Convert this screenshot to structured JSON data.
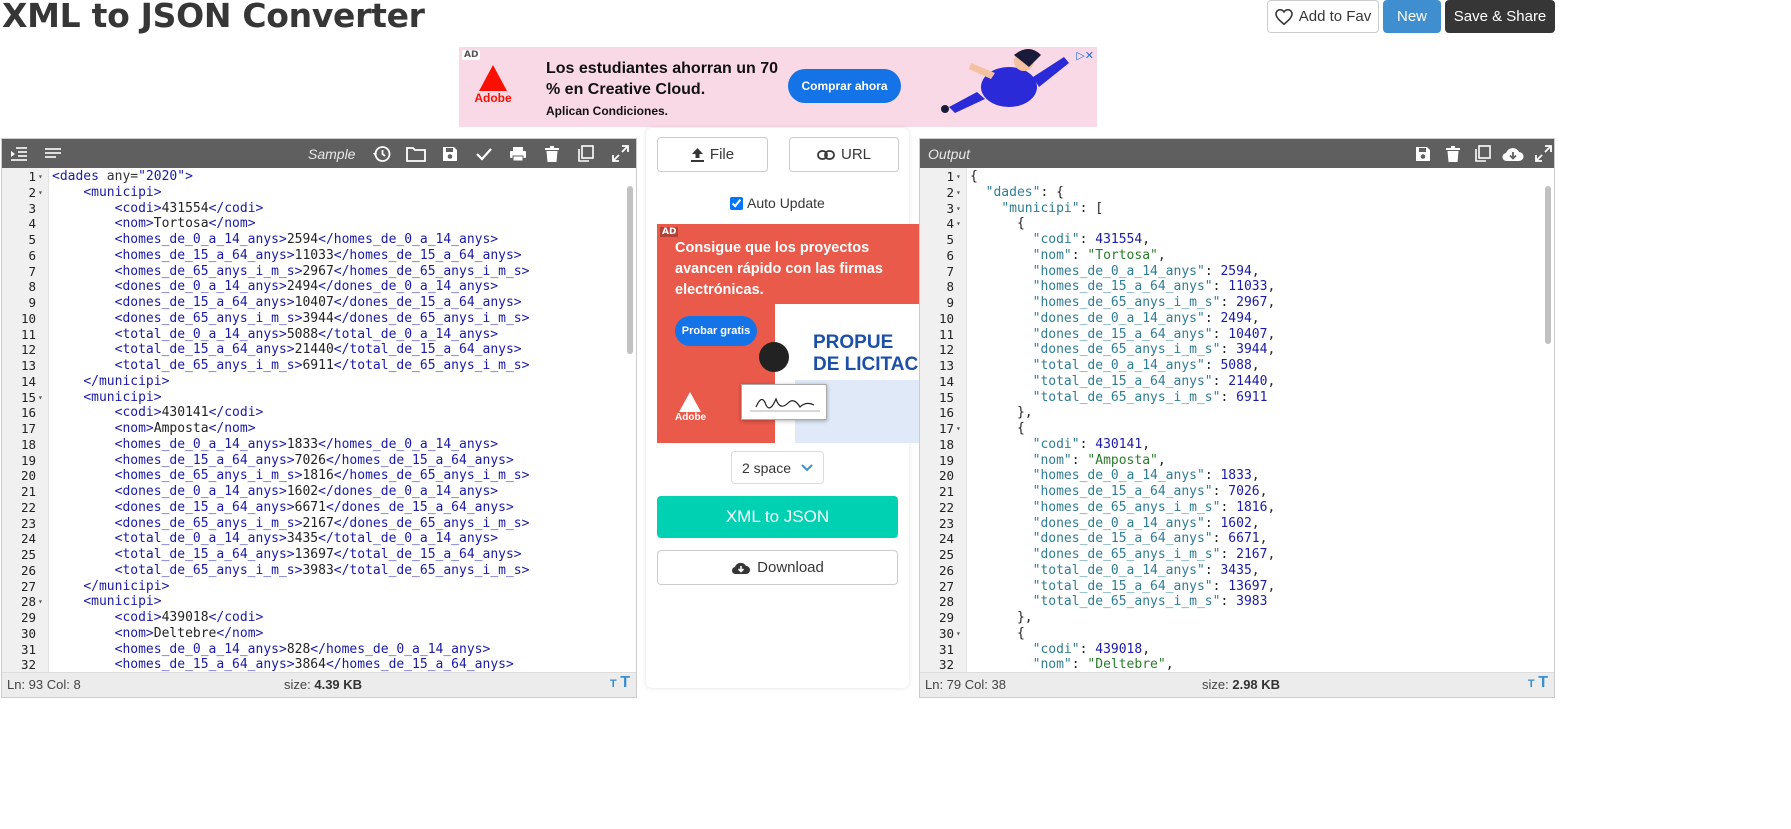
{
  "page": {
    "title": "XML to JSON Converter"
  },
  "header_buttons": {
    "fav": "Add to Fav",
    "new": "New",
    "save_share": "Save & Share"
  },
  "ad_banner": {
    "tag": "AD",
    "brand": "Adobe",
    "headline": "Los estudiantes ahorran un 70 % en Creative Cloud.",
    "sub": "Aplican Condiciones.",
    "cta": "Comprar ahora"
  },
  "left_editor": {
    "toolbar_label": "Sample",
    "status_pos": "Ln: 93 Col: 8",
    "size_label": "size:",
    "size_value": "4.39 KB",
    "lines": [
      {
        "n": "1",
        "fold": true,
        "indent": 0,
        "kind": "open",
        "tag": "dades",
        "attr": "any",
        "val": "2020"
      },
      {
        "n": "2",
        "fold": true,
        "indent": 1,
        "kind": "open",
        "tag": "municipi"
      },
      {
        "n": "3",
        "indent": 2,
        "kind": "el",
        "tag": "codi",
        "text": "431554"
      },
      {
        "n": "4",
        "indent": 2,
        "kind": "el",
        "tag": "nom",
        "text": "Tortosa"
      },
      {
        "n": "5",
        "indent": 2,
        "kind": "el",
        "tag": "homes_de_0_a_14_anys",
        "text": "2594"
      },
      {
        "n": "6",
        "indent": 2,
        "kind": "el",
        "tag": "homes_de_15_a_64_anys",
        "text": "11033"
      },
      {
        "n": "7",
        "indent": 2,
        "kind": "el",
        "tag": "homes_de_65_anys_i_m_s",
        "text": "2967"
      },
      {
        "n": "8",
        "indent": 2,
        "kind": "el",
        "tag": "dones_de_0_a_14_anys",
        "text": "2494"
      },
      {
        "n": "9",
        "indent": 2,
        "kind": "el",
        "tag": "dones_de_15_a_64_anys",
        "text": "10407"
      },
      {
        "n": "10",
        "indent": 2,
        "kind": "el",
        "tag": "dones_de_65_anys_i_m_s",
        "text": "3944"
      },
      {
        "n": "11",
        "indent": 2,
        "kind": "el",
        "tag": "total_de_0_a_14_anys",
        "text": "5088"
      },
      {
        "n": "12",
        "indent": 2,
        "kind": "el",
        "tag": "total_de_15_a_64_anys",
        "text": "21440"
      },
      {
        "n": "13",
        "indent": 2,
        "kind": "el",
        "tag": "total_de_65_anys_i_m_s",
        "text": "6911"
      },
      {
        "n": "14",
        "indent": 1,
        "kind": "close",
        "tag": "municipi"
      },
      {
        "n": "15",
        "fold": true,
        "indent": 1,
        "kind": "open",
        "tag": "municipi"
      },
      {
        "n": "16",
        "indent": 2,
        "kind": "el",
        "tag": "codi",
        "text": "430141"
      },
      {
        "n": "17",
        "indent": 2,
        "kind": "el",
        "tag": "nom",
        "text": "Amposta"
      },
      {
        "n": "18",
        "indent": 2,
        "kind": "el",
        "tag": "homes_de_0_a_14_anys",
        "text": "1833"
      },
      {
        "n": "19",
        "indent": 2,
        "kind": "el",
        "tag": "homes_de_15_a_64_anys",
        "text": "7026"
      },
      {
        "n": "20",
        "indent": 2,
        "kind": "el",
        "tag": "homes_de_65_anys_i_m_s",
        "text": "1816"
      },
      {
        "n": "21",
        "indent": 2,
        "kind": "el",
        "tag": "dones_de_0_a_14_anys",
        "text": "1602"
      },
      {
        "n": "22",
        "indent": 2,
        "kind": "el",
        "tag": "dones_de_15_a_64_anys",
        "text": "6671"
      },
      {
        "n": "23",
        "indent": 2,
        "kind": "el",
        "tag": "dones_de_65_anys_i_m_s",
        "text": "2167"
      },
      {
        "n": "24",
        "indent": 2,
        "kind": "el",
        "tag": "total_de_0_a_14_anys",
        "text": "3435"
      },
      {
        "n": "25",
        "indent": 2,
        "kind": "el",
        "tag": "total_de_15_a_64_anys",
        "text": "13697"
      },
      {
        "n": "26",
        "indent": 2,
        "kind": "el",
        "tag": "total_de_65_anys_i_m_s",
        "text": "3983"
      },
      {
        "n": "27",
        "indent": 1,
        "kind": "close",
        "tag": "municipi"
      },
      {
        "n": "28",
        "fold": true,
        "indent": 1,
        "kind": "open",
        "tag": "municipi"
      },
      {
        "n": "29",
        "indent": 2,
        "kind": "el",
        "tag": "codi",
        "text": "439018"
      },
      {
        "n": "30",
        "indent": 2,
        "kind": "el",
        "tag": "nom",
        "text": "Deltebre"
      },
      {
        "n": "31",
        "indent": 2,
        "kind": "el",
        "tag": "homes_de_0_a_14_anys",
        "text": "828"
      },
      {
        "n": "32",
        "indent": 2,
        "kind": "el",
        "tag": "homes_de_15_a_64_anys",
        "text": "3864"
      }
    ]
  },
  "middle": {
    "file_btn": "File",
    "url_btn": "URL",
    "auto_update": "Auto Update",
    "auto_update_checked": true,
    "ad": {
      "tag": "AD",
      "headline": "Consigue que los proyectos avancen rápido con las firmas electrónicas.",
      "cta": "Probar gratis",
      "brand": "Adobe",
      "doc_title_1": "PROPUE",
      "doc_title_2": "DE LICITAC"
    },
    "indent_select": "2 space",
    "convert_btn": "XML to JSON",
    "download_btn": "Download"
  },
  "right_editor": {
    "toolbar_label": "Output",
    "status_pos": "Ln: 79 Col: 38",
    "size_label": "size:",
    "size_value": "2.98 KB",
    "lines": [
      {
        "n": "1",
        "fold": true,
        "indent": 0,
        "kind": "pun",
        "text": "{"
      },
      {
        "n": "2",
        "fold": true,
        "indent": 1,
        "kind": "keyopen",
        "key": "dades",
        "open": "{"
      },
      {
        "n": "3",
        "fold": true,
        "indent": 2,
        "kind": "keyopen",
        "key": "municipi",
        "open": "["
      },
      {
        "n": "4",
        "fold": true,
        "indent": 3,
        "kind": "pun",
        "text": "{"
      },
      {
        "n": "5",
        "indent": 4,
        "kind": "num",
        "key": "codi",
        "val": "431554",
        "comma": true
      },
      {
        "n": "6",
        "indent": 4,
        "kind": "str",
        "key": "nom",
        "val": "Tortosa",
        "comma": true
      },
      {
        "n": "7",
        "indent": 4,
        "kind": "num",
        "key": "homes_de_0_a_14_anys",
        "val": "2594",
        "comma": true
      },
      {
        "n": "8",
        "indent": 4,
        "kind": "num",
        "key": "homes_de_15_a_64_anys",
        "val": "11033",
        "comma": true
      },
      {
        "n": "9",
        "indent": 4,
        "kind": "num",
        "key": "homes_de_65_anys_i_m_s",
        "val": "2967",
        "comma": true
      },
      {
        "n": "10",
        "indent": 4,
        "kind": "num",
        "key": "dones_de_0_a_14_anys",
        "val": "2494",
        "comma": true
      },
      {
        "n": "11",
        "indent": 4,
        "kind": "num",
        "key": "dones_de_15_a_64_anys",
        "val": "10407",
        "comma": true
      },
      {
        "n": "12",
        "indent": 4,
        "kind": "num",
        "key": "dones_de_65_anys_i_m_s",
        "val": "3944",
        "comma": true
      },
      {
        "n": "13",
        "indent": 4,
        "kind": "num",
        "key": "total_de_0_a_14_anys",
        "val": "5088",
        "comma": true
      },
      {
        "n": "14",
        "indent": 4,
        "kind": "num",
        "key": "total_de_15_a_64_anys",
        "val": "21440",
        "comma": true
      },
      {
        "n": "15",
        "indent": 4,
        "kind": "num",
        "key": "total_de_65_anys_i_m_s",
        "val": "6911",
        "comma": false
      },
      {
        "n": "16",
        "indent": 3,
        "kind": "pun",
        "text": "},"
      },
      {
        "n": "17",
        "fold": true,
        "indent": 3,
        "kind": "pun",
        "text": "{"
      },
      {
        "n": "18",
        "indent": 4,
        "kind": "num",
        "key": "codi",
        "val": "430141",
        "comma": true
      },
      {
        "n": "19",
        "indent": 4,
        "kind": "str",
        "key": "nom",
        "val": "Amposta",
        "comma": true
      },
      {
        "n": "20",
        "indent": 4,
        "kind": "num",
        "key": "homes_de_0_a_14_anys",
        "val": "1833",
        "comma": true
      },
      {
        "n": "21",
        "indent": 4,
        "kind": "num",
        "key": "homes_de_15_a_64_anys",
        "val": "7026",
        "comma": true
      },
      {
        "n": "22",
        "indent": 4,
        "kind": "num",
        "key": "homes_de_65_anys_i_m_s",
        "val": "1816",
        "comma": true
      },
      {
        "n": "23",
        "indent": 4,
        "kind": "num",
        "key": "dones_de_0_a_14_anys",
        "val": "1602",
        "comma": true
      },
      {
        "n": "24",
        "indent": 4,
        "kind": "num",
        "key": "dones_de_15_a_64_anys",
        "val": "6671",
        "comma": true
      },
      {
        "n": "25",
        "indent": 4,
        "kind": "num",
        "key": "dones_de_65_anys_i_m_s",
        "val": "2167",
        "comma": true
      },
      {
        "n": "26",
        "indent": 4,
        "kind": "num",
        "key": "total_de_0_a_14_anys",
        "val": "3435",
        "comma": true
      },
      {
        "n": "27",
        "indent": 4,
        "kind": "num",
        "key": "total_de_15_a_64_anys",
        "val": "13697",
        "comma": true
      },
      {
        "n": "28",
        "indent": 4,
        "kind": "num",
        "key": "total_de_65_anys_i_m_s",
        "val": "3983",
        "comma": false
      },
      {
        "n": "29",
        "indent": 3,
        "kind": "pun",
        "text": "},"
      },
      {
        "n": "30",
        "fold": true,
        "indent": 3,
        "kind": "pun",
        "text": "{"
      },
      {
        "n": "31",
        "indent": 4,
        "kind": "num",
        "key": "codi",
        "val": "439018",
        "comma": true
      },
      {
        "n": "32",
        "indent": 4,
        "kind": "str",
        "key": "nom",
        "val": "Deltebre",
        "comma": true
      }
    ]
  },
  "colors": {
    "toolbar": "#5f5f5f",
    "new_btn": "#3e8ed0",
    "convert_btn": "#00d1b2",
    "save_btn": "#363636"
  },
  "icons": {
    "left_toolbar": [
      "indent-icon",
      "align-icon",
      "history-icon",
      "folder-icon",
      "save-icon",
      "check-icon",
      "print-icon",
      "trash-icon",
      "copy-icon",
      "expand-icon"
    ],
    "right_toolbar": [
      "save-icon",
      "trash-icon",
      "copy-icon",
      "cloud-download-icon",
      "expand-icon"
    ]
  }
}
